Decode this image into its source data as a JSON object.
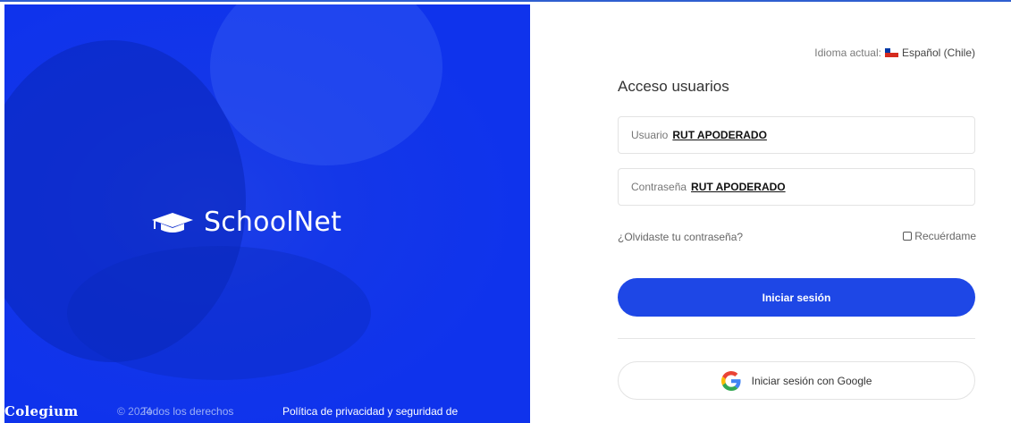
{
  "hero": {
    "brand_name": "SchoolNet",
    "footer": {
      "company": "Colegium",
      "copyright": "© 2024",
      "rights": "Todos los derechos",
      "privacy": "Política de privacidad y seguridad de"
    }
  },
  "language": {
    "label": "Idioma actual:",
    "value": "Español (Chile)",
    "flag_icon": "chile-flag-icon"
  },
  "login": {
    "title": "Acceso usuarios",
    "username": {
      "label": "Usuario",
      "value": "RUT APODERADO"
    },
    "password": {
      "label": "Contraseña",
      "value": "RUT APODERADO"
    },
    "forgot_label": "¿Olvidaste tu contraseña?",
    "remember_label": "Recuérdame",
    "submit_label": "Iniciar sesión",
    "google_label": "Iniciar sesión con Google"
  },
  "colors": {
    "accent": "#1e47e6",
    "hero_blue": "#1437e8"
  }
}
